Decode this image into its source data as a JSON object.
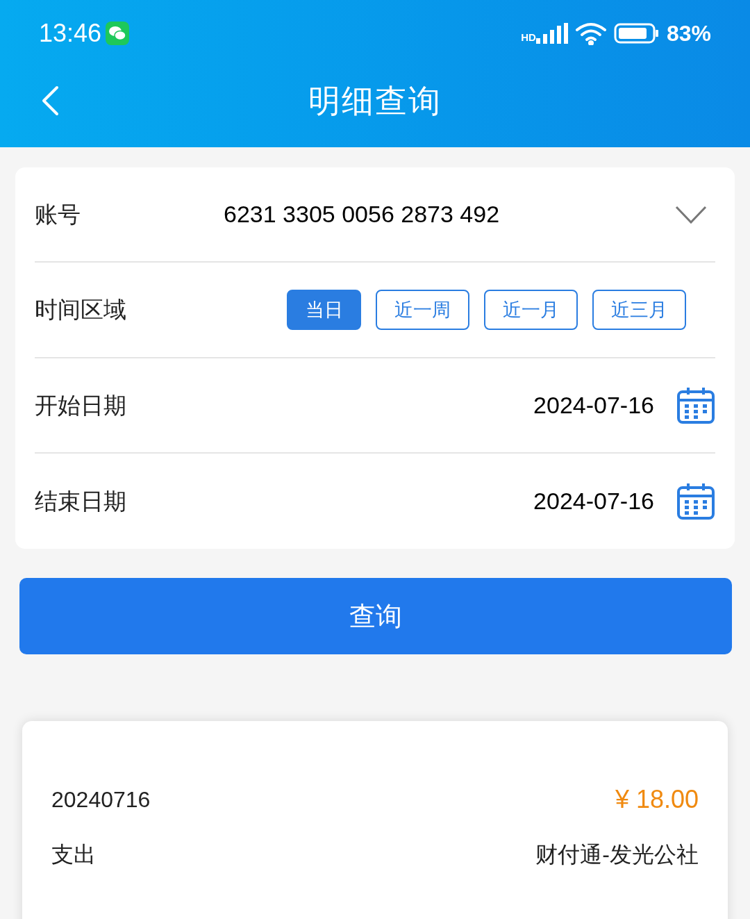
{
  "status_bar": {
    "time": "13:46",
    "network": "HD",
    "battery": "83%"
  },
  "header": {
    "title": "明细查询"
  },
  "form": {
    "account": {
      "label": "账号",
      "value": "6231 3305 0056 2873 492"
    },
    "time_range": {
      "label": "时间区域",
      "options": [
        {
          "label": "当日",
          "selected": true
        },
        {
          "label": "近一周",
          "selected": false
        },
        {
          "label": "近一月",
          "selected": false
        },
        {
          "label": "近三月",
          "selected": false
        }
      ]
    },
    "start_date": {
      "label": "开始日期",
      "value": "2024-07-16"
    },
    "end_date": {
      "label": "结束日期",
      "value": "2024-07-16"
    }
  },
  "query_button": "查询",
  "records": [
    {
      "date": "20240716",
      "amount": "¥ 18.00",
      "type": "支出",
      "merchant": "财付通-发光公社"
    }
  ]
}
